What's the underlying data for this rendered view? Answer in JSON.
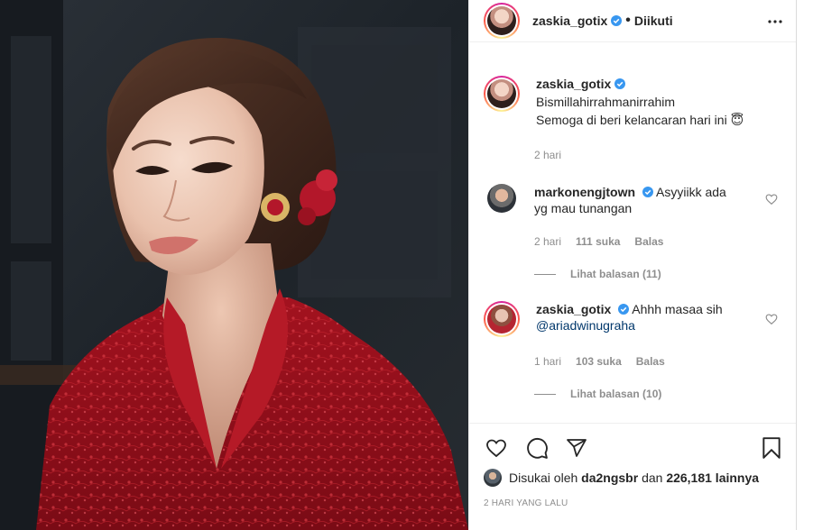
{
  "post": {
    "author": "zaskia_gotix",
    "follow_status": "Diikuti",
    "dot": "•"
  },
  "caption": {
    "username": "zaskia_gotix",
    "line1": "Bismillahirrahmanirrahim",
    "line2": "Semoga di beri kelancaran hari ini 😇",
    "time": "2 hari"
  },
  "comments": [
    {
      "username": "markonengjtown",
      "text_inline": "Asyyiikk ada",
      "text_cont": "yg mau tunangan",
      "time": "2 hari",
      "likes": "111 suka",
      "reply": "Balas",
      "view_replies": "Lihat balasan (11)"
    },
    {
      "username": "zaskia_gotix",
      "text_inline": "Ahhh masaa sih",
      "text_cont": "@ariadwinugraha",
      "time": "1 hari",
      "likes": "103 suka",
      "reply": "Balas",
      "view_replies": "Lihat balasan (10)"
    }
  ],
  "likes": {
    "prefix": "Disukai oleh",
    "user": "da2ngsbr",
    "middle": "dan",
    "count": "226,181 lainnya"
  },
  "timestamp": "2 HARI YANG LALU",
  "colors": {
    "verified": "#3897f0",
    "muted": "#8e8e8e",
    "text": "#262626",
    "mention": "#00376b"
  },
  "icons": [
    "more-options-icon",
    "verified-icon",
    "heart-icon",
    "comment-icon",
    "share-icon",
    "bookmark-icon"
  ]
}
